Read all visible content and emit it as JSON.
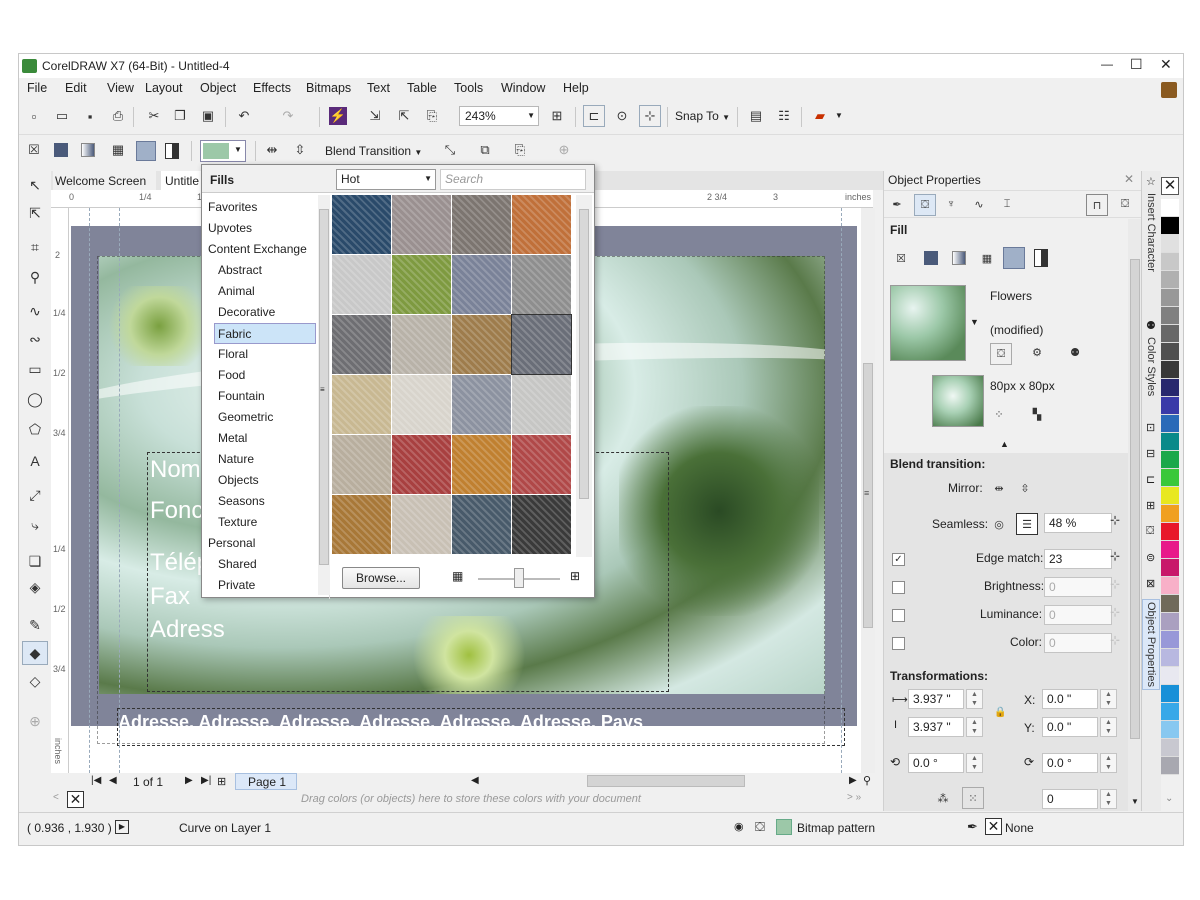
{
  "window": {
    "title": "CorelDRAW X7 (64-Bit) - Untitled-4",
    "controls": {
      "minimize": "—",
      "maximize": "☐",
      "close": "✕"
    }
  },
  "menu": [
    "File",
    "Edit",
    "View",
    "Layout",
    "Object",
    "Effects",
    "Bitmaps",
    "Text",
    "Table",
    "Tools",
    "Window",
    "Help"
  ],
  "toolbar": {
    "zoom": "243%",
    "snap_to": "Snap To"
  },
  "propertybar": {
    "blend_transition": "Blend Transition"
  },
  "doc_tabs": {
    "welcome": "Welcome Screen",
    "untitled": "Untitle"
  },
  "ruler": {
    "unit": "inches",
    "h_ticks": [
      "0",
      "1/4",
      "1/2",
      "2 3/4",
      "3",
      "inches"
    ],
    "v_ticks": [
      "2",
      "1/4",
      "1/2",
      "3/4",
      "1/4",
      "1/2",
      "3/4",
      "1/4"
    ]
  },
  "fills_popup": {
    "title": "Fills",
    "filter": "Hot",
    "search_placeholder": "Search",
    "categories": [
      {
        "label": "Favorites",
        "indent": false,
        "selected": false
      },
      {
        "label": "Upvotes",
        "indent": false,
        "selected": false
      },
      {
        "label": "Content Exchange",
        "indent": false,
        "selected": false
      },
      {
        "label": "Abstract",
        "indent": true,
        "selected": false
      },
      {
        "label": "Animal",
        "indent": true,
        "selected": false
      },
      {
        "label": "Decorative",
        "indent": true,
        "selected": false
      },
      {
        "label": "Fabric",
        "indent": true,
        "selected": true
      },
      {
        "label": "Floral",
        "indent": true,
        "selected": false
      },
      {
        "label": "Food",
        "indent": true,
        "selected": false
      },
      {
        "label": "Fountain",
        "indent": true,
        "selected": false
      },
      {
        "label": "Geometric",
        "indent": true,
        "selected": false
      },
      {
        "label": "Metal",
        "indent": true,
        "selected": false
      },
      {
        "label": "Nature",
        "indent": true,
        "selected": false
      },
      {
        "label": "Objects",
        "indent": true,
        "selected": false
      },
      {
        "label": "Seasons",
        "indent": true,
        "selected": false
      },
      {
        "label": "Texture",
        "indent": true,
        "selected": false
      },
      {
        "label": "Personal",
        "indent": false,
        "selected": false
      },
      {
        "label": "Shared",
        "indent": true,
        "selected": false
      },
      {
        "label": "Private",
        "indent": true,
        "selected": false
      }
    ],
    "browse": "Browse...",
    "tiles": [
      {
        "name": "sunflower-tile",
        "color": "#2a4a6a"
      },
      {
        "name": "stone-tile",
        "color": "#9a9090"
      },
      {
        "name": "granite-tile",
        "color": "#7c7570"
      },
      {
        "name": "plaid-tile",
        "color": "#c0703a"
      },
      {
        "name": "white-bark-tile",
        "color": "#c8c8c8"
      },
      {
        "name": "green-leaf-tile",
        "color": "#7e9a40"
      },
      {
        "name": "bottles-tile",
        "color": "#7a8298"
      },
      {
        "name": "gray-weave-tile",
        "color": "#8e8e8e"
      },
      {
        "name": "speckle-tile",
        "color": "#6e6e72"
      },
      {
        "name": "linen-tile",
        "color": "#b8b2a8"
      },
      {
        "name": "burlap-tile",
        "color": "#9e7c4c"
      },
      {
        "name": "denim-tile",
        "color": "#6a6e78"
      },
      {
        "name": "stripe-tile",
        "color": "#c8b892"
      },
      {
        "name": "paper-tile",
        "color": "#d8d4cc"
      },
      {
        "name": "blue-gravel-tile",
        "color": "#8c92a0"
      },
      {
        "name": "white-gravel-tile",
        "color": "#c6c6c4"
      },
      {
        "name": "beige-weave-tile",
        "color": "#b8ae9e"
      },
      {
        "name": "red-brick-tile",
        "color": "#a84040"
      },
      {
        "name": "orange-grid-tile",
        "color": "#c08030"
      },
      {
        "name": "red-cloth-tile",
        "color": "#b04848"
      },
      {
        "name": "wood-tile",
        "color": "#a87838"
      },
      {
        "name": "cream-tile",
        "color": "#c8c0b4"
      },
      {
        "name": "blue-stripe-tile",
        "color": "#485a6a"
      },
      {
        "name": "dark-lace-tile",
        "color": "#3a3a3a"
      }
    ]
  },
  "canvas": {
    "text_lines": [
      "Nom e",
      "Fonctio",
      "Téléph",
      "Fax",
      "Adress"
    ],
    "address_line": "Adresse, Adresse, Adresse, Adresse, Adresse, Adresse, Pays"
  },
  "page_nav": {
    "count": "1 of 1",
    "tab": "Page 1"
  },
  "palette_hint": "Drag colors (or objects) here to store these colors with your document",
  "status": {
    "coords": "( 0.936 , 1.930 )",
    "layer": "Curve on Layer 1",
    "fill": "Bitmap pattern",
    "outline": "None"
  },
  "object_properties": {
    "title": "Object Properties",
    "fill_label": "Fill",
    "pattern_name": "Flowers",
    "pattern_modified": "(modified)",
    "size": "80px x 80px",
    "blend_transition_label": "Blend transition:",
    "mirror_label": "Mirror:",
    "seamless_label": "Seamless:",
    "seamless_value": "48 %",
    "edge_match_label": "Edge match:",
    "edge_match_value": "23",
    "brightness_label": "Brightness:",
    "brightness_value": "0",
    "luminance_label": "Luminance:",
    "luminance_value": "0",
    "color_label": "Color:",
    "color_value": "0",
    "transformations_label": "Transformations:",
    "width": "3.937 \"",
    "height": "3.937 \"",
    "x_label": "X:",
    "x": "0.0 \"",
    "y_label": "Y:",
    "y": "0.0 \"",
    "rotate": "0.0 °",
    "skew": "0.0 °",
    "last": "0"
  },
  "dock_tabs": [
    "Insert Character",
    "Color Styles",
    "Object Properties"
  ],
  "palette": [
    "#ffffff",
    "#000000",
    "#e0e0e0",
    "#c8c8c8",
    "#b0b0b0",
    "#989898",
    "#808080",
    "#686868",
    "#505050",
    "#383838",
    "#28286e",
    "#3a3aa8",
    "#2a6ab8",
    "#0a8a8a",
    "#1aa84a",
    "#3ac83a",
    "#e8e820",
    "#f0a020",
    "#e8182a",
    "#e8188a",
    "#c8186a",
    "#f8b0c8",
    "#706a5a",
    "#aaa0c0",
    "#9898d8",
    "#b8b8e0",
    "#e8e8f0",
    "#1890d8",
    "#38a8e8",
    "#88c8f0",
    "#c8c8d0",
    "#a8a8b0"
  ]
}
